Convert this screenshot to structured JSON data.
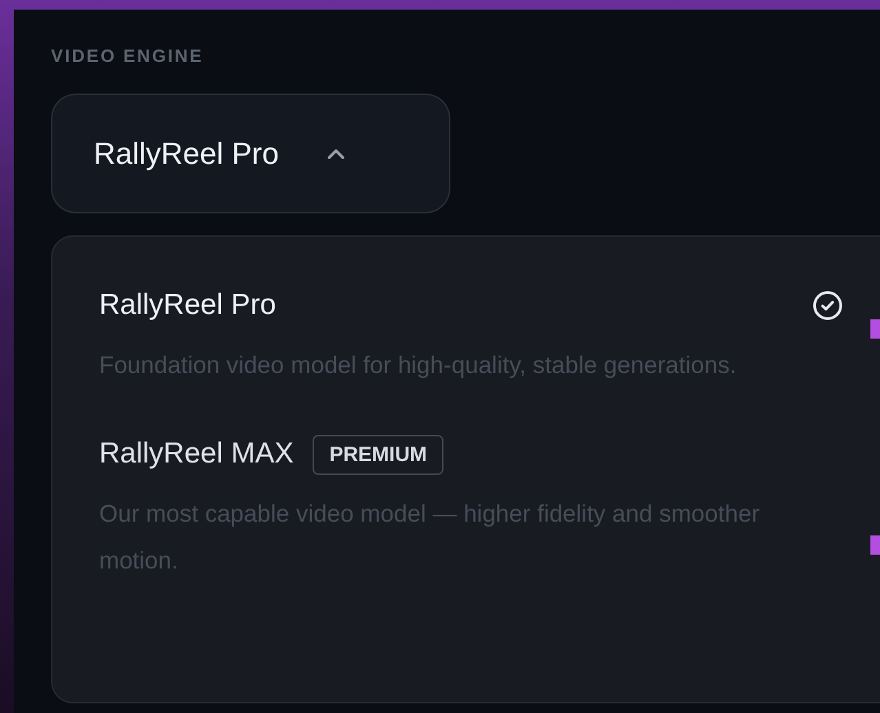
{
  "section_label": "VIDEO ENGINE",
  "dropdown": {
    "value": "RallyReel Pro",
    "expanded": true
  },
  "options": [
    {
      "name": "RallyReel Pro",
      "description": "Foundation video model for high-quality, stable generations.",
      "selected": true
    },
    {
      "name": "RallyReel MAX",
      "badge": "PREMIUM",
      "description": "Our most capable video model — higher fidelity and smoother motion.",
      "selected": false
    }
  ]
}
